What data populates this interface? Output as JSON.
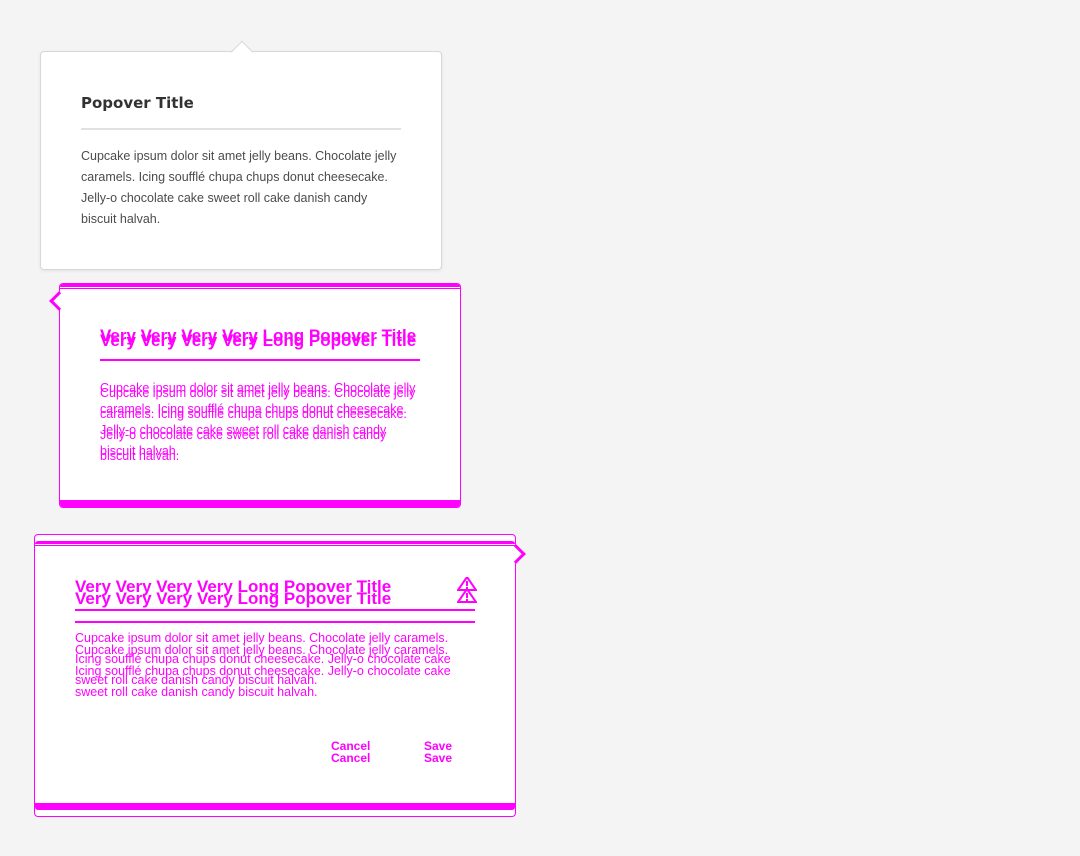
{
  "popover_basic": {
    "title": "Popover Title",
    "body": "Cupcake ipsum dolor sit amet jelly beans. Chocolate jelly caramels. Icing soufflé chupa chups donut cheesecake. Jelly-o chocolate cake sweet roll cake danish candy biscuit halvah."
  },
  "popover_long_title": {
    "title": "Very Very Very Very Long Popover Title",
    "body": "Cupcake ipsum dolor sit amet jelly beans. Chocolate jelly caramels. Icing soufflé chupa chups donut cheesecake. Jelly-o chocolate cake sweet roll cake danish candy biscuit halvah."
  },
  "popover_dialog": {
    "title": "Very Very Very Very Long Popover Title",
    "body": "Cupcake ipsum dolor sit amet jelly beans. Chocolate jelly caramels. Icing soufflé chupa chups donut cheesecake. Jelly-o chocolate cake sweet roll cake danish candy biscuit halvah.",
    "cancel_label": "Cancel",
    "save_label": "Save",
    "icon": "alert-icon"
  },
  "colors": {
    "background": "#f4f4f4",
    "popover_bg": "#ffffff",
    "title_text": "#323232",
    "body_text": "#4b4b4b",
    "overlay_accent": "#ff00ff"
  }
}
